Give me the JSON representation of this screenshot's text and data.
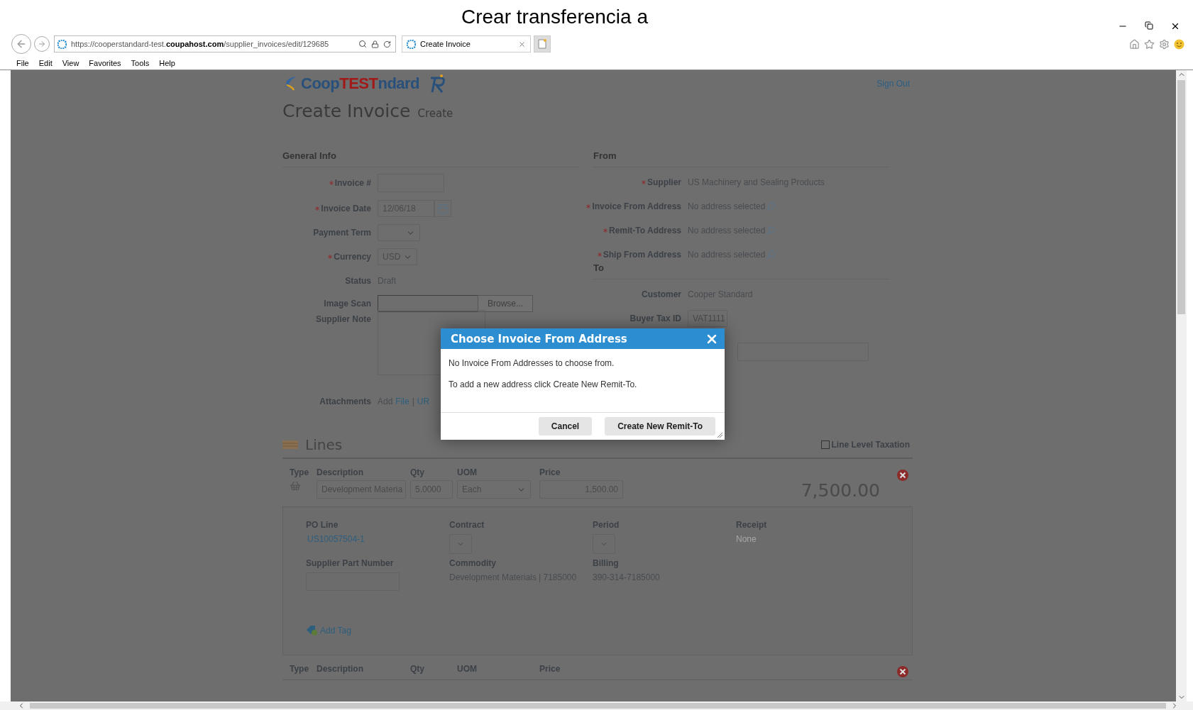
{
  "window": {
    "caption": "Crear transferencia a"
  },
  "browser": {
    "url": "https://cooperstandard-test.**coupahost.com**/supplier_invoices/edit/129685",
    "tab": "Create Invoice",
    "menu": [
      "File",
      "Edit",
      "View",
      "Favorites",
      "Tools",
      "Help"
    ]
  },
  "header": {
    "logo_left": "Coop",
    "logo_badge": "TEST",
    "logo_right": "ndard",
    "sign_out": "Sign Out",
    "title": "Create Invoice",
    "subtitle": "Create"
  },
  "general_info": {
    "heading": "General Info",
    "fields": [
      {
        "kind": "text",
        "label": "Invoice #",
        "required": true
      },
      {
        "kind": "date",
        "label": "Invoice Date",
        "required": true,
        "value": "12/06/18"
      },
      {
        "kind": "select",
        "label": "Payment Term",
        "required": false
      },
      {
        "kind": "select",
        "label": "Currency",
        "required": true,
        "value": "USD"
      },
      {
        "kind": "static",
        "label": "Status",
        "required": false,
        "value": "Draft"
      },
      {
        "kind": "file",
        "label": "Image Scan",
        "required": false,
        "button": "Browse..."
      },
      {
        "kind": "textarea",
        "label": "Supplier Note",
        "required": false
      },
      {
        "kind": "links",
        "label": "Attachments",
        "required": false,
        "prefix": "Add",
        "links": [
          "File",
          "UR"
        ],
        "separator": "|"
      }
    ]
  },
  "from": {
    "heading": "From",
    "fields": [
      {
        "kind": "static",
        "label": "Supplier",
        "required": true,
        "value": "US Machinery and Sealing Products"
      },
      {
        "kind": "lookup",
        "label": "Invoice From Address",
        "required": true,
        "value": "No address selected"
      },
      {
        "kind": "lookup",
        "label": "Remit-To Address",
        "required": true,
        "value": "No address selected"
      },
      {
        "kind": "lookup",
        "label": "Ship From Address",
        "required": true,
        "value": "No address selected"
      }
    ]
  },
  "to": {
    "heading": "To",
    "fields": [
      {
        "kind": "static",
        "label": "Customer",
        "required": false,
        "value": "Cooper Standard"
      },
      {
        "kind": "select",
        "label": "Buyer Tax ID",
        "required": false,
        "value": "VAT1111"
      },
      {
        "kind": "input",
        "required": false
      }
    ]
  },
  "dialog": {
    "title": "Choose Invoice From Address",
    "messages": [
      "No Invoice From Addresses to choose from.",
      "To add a new address click Create New Remit-To."
    ],
    "buttons": [
      "Cancel",
      "Create New Remit-To"
    ]
  },
  "lines": {
    "heading": "Lines",
    "taxation": {
      "label": "Line Level Taxation",
      "checked": false
    },
    "items": [
      {
        "columns": [
          "Type",
          "Description",
          "Qty",
          "UOM",
          "Price"
        ],
        "description": "Development Materia",
        "qty": "5.0000",
        "uom": "Each",
        "price": "1,500.00",
        "total": "7,500.00",
        "details": {
          "po_line_label": "PO Line",
          "po_line": "US10057504-1",
          "contract_label": "Contract",
          "period_label": "Period",
          "receipt_label": "Receipt",
          "receipt": "None",
          "part_label": "Supplier Part Number",
          "commodity_label": "Commodity",
          "commodity": "Development Materials | 7185000",
          "billing_label": "Billing",
          "billing": "390-314-7185000",
          "add_tag": "Add Tag"
        }
      },
      {
        "columns": [
          "Type",
          "Description",
          "Qty",
          "UOM",
          "Price"
        ]
      }
    ]
  }
}
